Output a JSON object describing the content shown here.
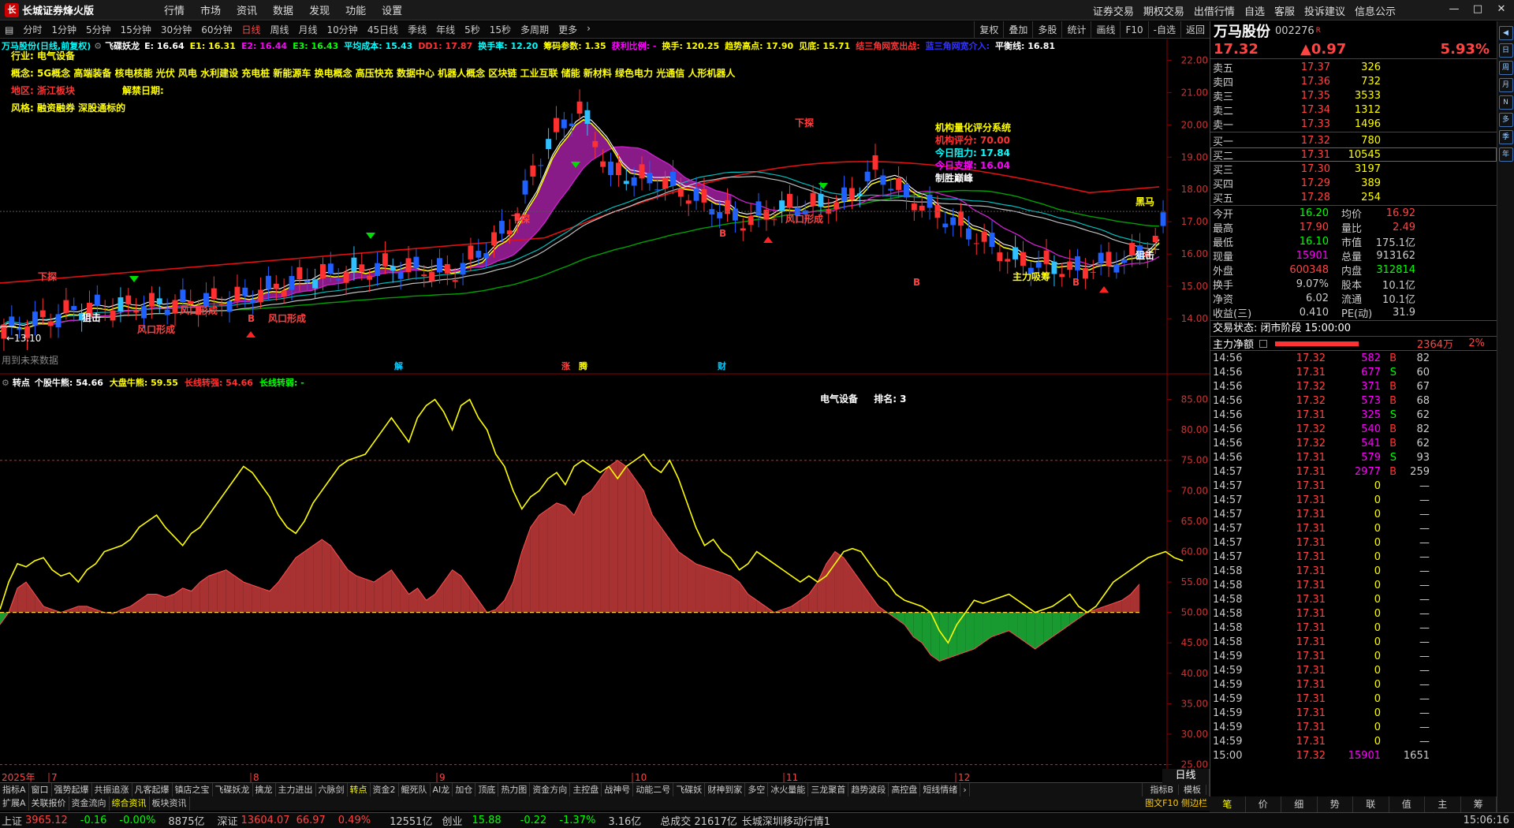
{
  "app": {
    "title": "长城证券烽火版",
    "logo": "长"
  },
  "menu": [
    "行情",
    "市场",
    "资讯",
    "数据",
    "发现",
    "功能",
    "设置"
  ],
  "right_menu": [
    "证券交易",
    "期权交易",
    "出借行情",
    "自选",
    "客服",
    "投诉建议",
    "信息公示"
  ],
  "periods": [
    "分时",
    "1分钟",
    "5分钟",
    "15分钟",
    "30分钟",
    "60分钟",
    "日线",
    "周线",
    "月线",
    "10分钟",
    "45日线",
    "季线",
    "年线",
    "5秒",
    "15秒",
    "多周期",
    "更多"
  ],
  "active_period": "日线",
  "period_right": [
    "复权",
    "叠加",
    "多股",
    "统计",
    "画线",
    "F10",
    "-自选",
    "返回"
  ],
  "kline": {
    "header_name": "万马股份(日线,前复权)",
    "indicator_name": "飞碟妖龙",
    "values": [
      {
        "t": "E: 16.64",
        "c": "#fff"
      },
      {
        "t": "E1: 16.31",
        "c": "#ff0"
      },
      {
        "t": "E2: 16.44",
        "c": "#f0f"
      },
      {
        "t": "E3: 16.43",
        "c": "#0f0"
      },
      {
        "t": "平均成本: 15.43",
        "c": "#0ff"
      },
      {
        "t": "DD1: 17.87",
        "c": "#f33"
      },
      {
        "t": "换手率: 12.20",
        "c": "#0ff"
      },
      {
        "t": "筹码参数: 1.35",
        "c": "#ff0"
      },
      {
        "t": "获利比例: -",
        "c": "#f0f"
      },
      {
        "t": "换手: 120.25",
        "c": "#ff0"
      },
      {
        "t": "趋势高点: 17.90",
        "c": "#ff0"
      },
      {
        "t": "见底: 15.71",
        "c": "#ff0"
      },
      {
        "t": "结三角网宽出战:",
        "c": "#f33"
      },
      {
        "t": "蓝三角网宽介入:",
        "c": "#33f"
      },
      {
        "t": "平衡线: 16.81",
        "c": "#fff"
      }
    ],
    "industry": "行业: 电气设备",
    "concept": "概念: 5G概念 高端装备 核电核能 光伏 风电 水利建设 充电桩 新能源车 换电概念 高压快充 数据中心 机器人概念 区块链 工业互联 储能 新材料 绿色电力 光通信 人形机器人",
    "region": "地区: 浙江板块",
    "unlock": "解禁日期:",
    "style": "风格: 融资融券 深股通标的",
    "score_title": "机构量化评分系统",
    "score": "机构评分: 70.00",
    "resistance": "今日阻力: 17.84",
    "support": "今日支撑: 16.04",
    "brand": "制胜巅峰",
    "low_label": "←13.10",
    "future_label": "用到未来数据",
    "marks": {
      "jie": "解",
      "zhang": "涨",
      "teng": "腾",
      "cai": "财"
    },
    "labels": {
      "xiatan": "下探",
      "juji": "狙击",
      "fengkou": "风口形成",
      "heima": "黑马",
      "zhuli": "主力吸筹",
      "b": "B"
    },
    "yaxis": [
      22.0,
      21.0,
      20.0,
      19.0,
      18.0,
      17.0,
      16.0,
      15.0,
      14.0
    ],
    "ylim": [
      13.0,
      22.4
    ]
  },
  "indicator": {
    "name": "转点",
    "values": [
      {
        "t": "个股牛熊: 54.66",
        "c": "#fff"
      },
      {
        "t": "大盘牛熊: 59.55",
        "c": "#ff0"
      },
      {
        "t": "长线转强: 54.66",
        "c": "#f33"
      },
      {
        "t": "长线转弱: -",
        "c": "#0f0"
      }
    ],
    "sector": "电气设备",
    "rank": "排名: 3",
    "yaxis": [
      85.0,
      80.0,
      75.0,
      70.0,
      65.0,
      60.0,
      55.0,
      50.0,
      45.0,
      40.0,
      35.0,
      30.0,
      25.0
    ],
    "ylim": [
      23.0,
      86.5
    ]
  },
  "chart_data": {
    "type": "line",
    "series": [
      {
        "name": "大盘牛熊",
        "values": [
          50.5,
          55,
          58,
          57.5,
          58.5,
          59,
          57,
          56,
          56.5,
          55,
          57,
          58,
          60,
          60.5,
          61,
          62,
          64,
          65,
          66,
          64,
          62.5,
          61,
          63,
          64,
          66,
          68,
          70,
          72,
          74,
          73,
          71,
          69,
          66,
          64,
          63,
          65,
          68,
          70,
          72,
          74,
          75,
          75.5,
          76,
          78,
          80,
          82,
          80,
          78,
          82,
          84,
          85,
          83,
          80,
          84,
          85,
          82,
          80,
          76,
          74,
          70,
          67,
          69,
          70,
          72,
          73,
          71,
          74,
          75,
          74,
          73,
          74,
          72,
          74,
          75,
          76,
          74,
          73,
          75,
          72,
          68,
          64,
          61,
          62,
          60,
          59,
          57,
          58,
          60,
          59,
          58,
          57,
          56,
          55,
          56,
          55,
          56,
          58,
          60,
          60.5,
          60,
          58,
          56,
          55,
          53,
          52,
          51.5,
          51,
          50,
          47,
          45,
          48,
          50,
          52,
          51.5,
          52,
          52.5,
          53,
          52,
          51,
          50,
          50.5,
          51,
          52,
          53,
          51,
          50,
          51,
          53,
          55,
          56,
          57,
          58,
          59,
          59.5,
          60,
          59,
          58.5
        ]
      },
      {
        "name": "个股牛熊",
        "values": [
          48,
          50,
          54,
          55,
          53,
          51,
          50.5,
          50,
          50.5,
          51,
          51,
          50.5,
          50,
          49.8,
          50.5,
          51,
          52,
          53,
          53,
          52.5,
          53,
          54,
          53.5,
          55,
          56,
          56.5,
          57,
          56,
          55,
          54.5,
          54,
          53.5,
          55,
          57,
          59,
          60,
          61,
          62,
          61,
          59,
          57,
          56,
          55.5,
          55,
          56,
          57,
          55,
          53,
          54,
          52,
          53,
          55,
          57,
          56,
          54,
          52,
          50,
          50.5,
          52,
          55,
          60,
          64,
          66,
          67,
          68,
          67.5,
          66,
          69,
          70,
          72,
          74,
          75,
          74,
          72,
          70,
          66,
          64,
          62,
          60,
          59,
          58,
          57.5,
          57,
          56.5,
          56,
          55,
          53,
          52,
          51,
          50,
          50.5,
          51,
          52,
          53,
          55,
          58,
          60,
          59,
          57,
          55,
          53,
          51,
          50,
          49,
          48,
          46,
          45,
          43,
          42,
          42.5,
          43,
          43.5,
          44,
          45,
          46,
          46.5,
          47,
          46,
          45,
          44,
          45,
          46,
          47,
          48,
          49,
          50,
          50.5,
          51,
          51.5,
          52,
          53,
          54.66
        ]
      }
    ],
    "ylim": [
      23.0,
      86.5
    ]
  },
  "dates": {
    "year": "2025年",
    "months": [
      "7",
      "8",
      "9",
      "10",
      "11",
      "12"
    ],
    "period_tag": "日线"
  },
  "tabs1": [
    "指标A",
    "窗口",
    "强势起爆",
    "共振追涨",
    "凡客起爆",
    "镇店之宝",
    "飞碟妖龙",
    "擒龙",
    "主力进出",
    "六脉剑",
    "转点",
    "资金2",
    "鲲死队",
    "AI龙",
    "加仓",
    "顶底",
    "热力图",
    "资金方向",
    "主控盘",
    "战神号",
    "动能二号",
    "飞碟妖",
    "财神到家",
    "多空",
    "冰火量能",
    "三龙聚首",
    "趋势波段",
    "高控盘",
    "短线情绪"
  ],
  "tabs1_active": "转点",
  "tabs1_right": [
    "指标B",
    "模板"
  ],
  "tabs2": [
    "扩展A",
    "关联报价",
    "资金流向",
    "综合资讯",
    "板块资讯"
  ],
  "tabs2_active": "综合资讯",
  "tabs2_right": "图文F10 侧边栏",
  "status": {
    "sh_label": "上证",
    "sh_val": "3965.12",
    "sh_chg": "-0.16",
    "sh_pct": "-0.00%",
    "sh_amt": "8875亿",
    "sz_label": "深证",
    "sz_val": "13604.07",
    "sz_chg": "66.97",
    "sz_pct": "0.49%",
    "sz_amt": "12551亿",
    "cy_label": "创业",
    "cy_val": "15.88",
    "cy_chg": "-0.22",
    "cy_pct": "-1.37%",
    "cy_amt": "3.16亿",
    "total": "总成交 21617亿",
    "broker": "长城深圳移动行情1",
    "time": "15:06:16"
  },
  "quote": {
    "name": "万马股份",
    "code": "002276",
    "tag": "R",
    "price": "17.32",
    "change": "▲0.97",
    "pct": "5.93%",
    "asks": [
      [
        "卖五",
        "17.37",
        "326"
      ],
      [
        "卖四",
        "17.36",
        "732"
      ],
      [
        "卖三",
        "17.35",
        "3533"
      ],
      [
        "卖二",
        "17.34",
        "1312"
      ],
      [
        "卖一",
        "17.33",
        "1496"
      ]
    ],
    "bids": [
      [
        "买一",
        "17.32",
        "780"
      ],
      [
        "买二",
        "17.31",
        "10545"
      ],
      [
        "买三",
        "17.30",
        "3197"
      ],
      [
        "买四",
        "17.29",
        "389"
      ],
      [
        "买五",
        "17.28",
        "254"
      ]
    ],
    "stats": [
      [
        "今开",
        "16.20",
        "#0f0",
        "均价",
        "16.92",
        "#f44"
      ],
      [
        "最高",
        "17.90",
        "#f44",
        "量比",
        "2.49",
        "#f44"
      ],
      [
        "最低",
        "16.10",
        "#0f0",
        "市值",
        "175.1亿",
        "#ccc"
      ],
      [
        "现量",
        "15901",
        "#f0f",
        "总量",
        "913162",
        "#ccc"
      ],
      [
        "外盘",
        "600348",
        "#f44",
        "内盘",
        "312814",
        "#0f0"
      ],
      [
        "换手",
        "9.07%",
        "#ccc",
        "股本",
        "10.1亿",
        "#ccc"
      ],
      [
        "净资",
        "6.02",
        "#ccc",
        "流通",
        "10.1亿",
        "#ccc"
      ],
      [
        "收益(三)",
        "0.410",
        "#ccc",
        "PE(动)",
        "31.9",
        "#ccc"
      ]
    ],
    "trade_status": "交易状态: 闭市阶段 15:00:00",
    "flow_label": "主力净额",
    "flow_val": "2364万",
    "flow_pct": "2%"
  },
  "ticks": [
    [
      "14:56",
      "17.32",
      "582",
      "B",
      "82"
    ],
    [
      "14:56",
      "17.31",
      "677",
      "S",
      "60"
    ],
    [
      "14:56",
      "17.32",
      "371",
      "B",
      "67"
    ],
    [
      "14:56",
      "17.32",
      "573",
      "B",
      "68"
    ],
    [
      "14:56",
      "17.31",
      "325",
      "S",
      "62"
    ],
    [
      "14:56",
      "17.32",
      "540",
      "B",
      "82"
    ],
    [
      "14:56",
      "17.32",
      "541",
      "B",
      "62"
    ],
    [
      "14:56",
      "17.31",
      "579",
      "S",
      "93"
    ],
    [
      "14:57",
      "17.31",
      "2977",
      "B",
      "259"
    ],
    [
      "14:57",
      "17.31",
      "0",
      "",
      ""
    ],
    [
      "14:57",
      "17.31",
      "0",
      "",
      ""
    ],
    [
      "14:57",
      "17.31",
      "0",
      "",
      ""
    ],
    [
      "14:57",
      "17.31",
      "0",
      "",
      ""
    ],
    [
      "14:57",
      "17.31",
      "0",
      "",
      ""
    ],
    [
      "14:57",
      "17.31",
      "0",
      "",
      ""
    ],
    [
      "14:58",
      "17.31",
      "0",
      "",
      ""
    ],
    [
      "14:58",
      "17.31",
      "0",
      "",
      ""
    ],
    [
      "14:58",
      "17.31",
      "0",
      "",
      ""
    ],
    [
      "14:58",
      "17.31",
      "0",
      "",
      ""
    ],
    [
      "14:58",
      "17.31",
      "0",
      "",
      ""
    ],
    [
      "14:58",
      "17.31",
      "0",
      "",
      ""
    ],
    [
      "14:59",
      "17.31",
      "0",
      "",
      ""
    ],
    [
      "14:59",
      "17.31",
      "0",
      "",
      ""
    ],
    [
      "14:59",
      "17.31",
      "0",
      "",
      ""
    ],
    [
      "14:59",
      "17.31",
      "0",
      "",
      ""
    ],
    [
      "14:59",
      "17.31",
      "0",
      "",
      ""
    ],
    [
      "14:59",
      "17.31",
      "0",
      "",
      ""
    ],
    [
      "14:59",
      "17.31",
      "0",
      "",
      ""
    ],
    [
      "15:00",
      "17.32",
      "15901",
      "",
      "1651"
    ]
  ],
  "right_tabs": [
    "笔",
    "价",
    "细",
    "势",
    "联",
    "值",
    "主",
    "筹"
  ],
  "sidebar_icons": [
    "◀",
    "日",
    "周",
    "月",
    "N",
    "多",
    "季",
    "年"
  ]
}
